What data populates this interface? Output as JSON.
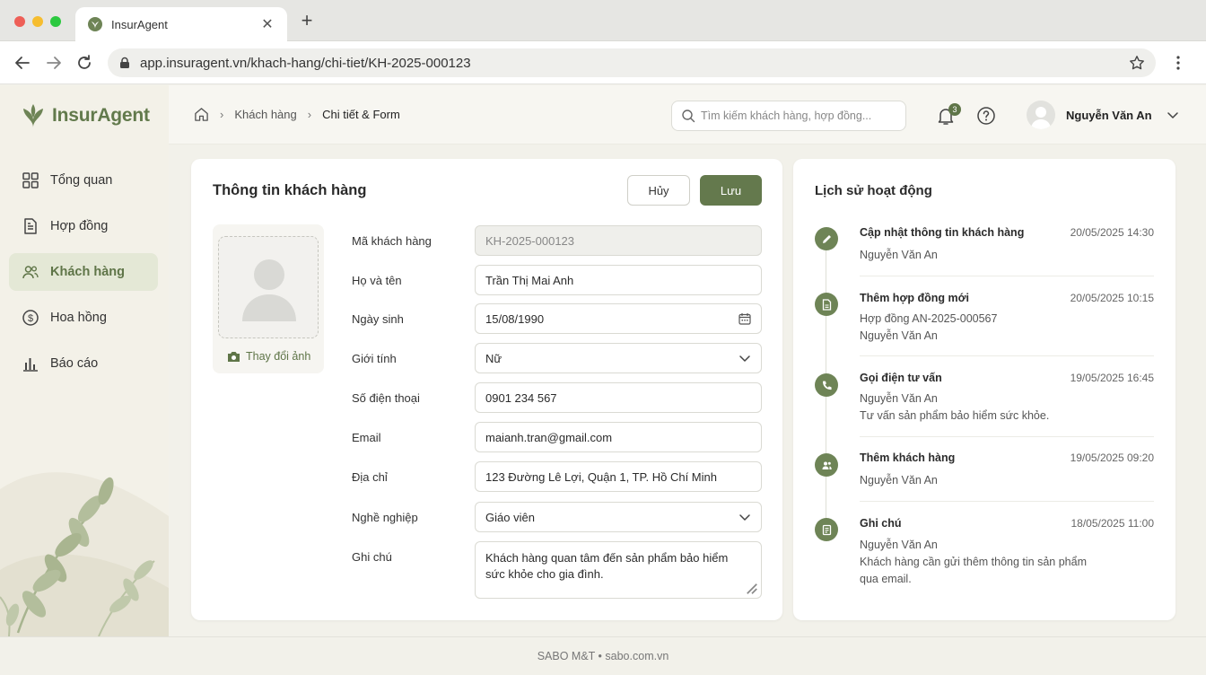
{
  "browser": {
    "tab_title": "InsurAgent",
    "url": "app.insuragent.vn/khach-hang/chi-tiet/KH-2025-000123",
    "icons": {
      "back": "back-arrow-icon",
      "forward": "forward-arrow-icon",
      "reload": "reload-icon",
      "lock": "lock-icon",
      "star": "star-icon",
      "menu": "kebab-menu-icon"
    }
  },
  "app": {
    "name": "InsurAgent",
    "accent": "#64794d"
  },
  "sidebar": {
    "items": [
      {
        "label": "Tổng quan",
        "icon": "dashboard-icon",
        "active": false
      },
      {
        "label": "Hợp đồng",
        "icon": "document-icon",
        "active": false
      },
      {
        "label": "Khách hàng",
        "icon": "users-icon",
        "active": true
      },
      {
        "label": "Hoa hồng",
        "icon": "dollar-circle-icon",
        "active": false
      },
      {
        "label": "Báo cáo",
        "icon": "bar-chart-icon",
        "active": false
      }
    ]
  },
  "header": {
    "breadcrumb": [
      "Khách hàng",
      "Chi tiết & Form"
    ],
    "search_placeholder": "Tìm kiếm khách hàng, hợp đồng...",
    "notification_count": "3",
    "user_name": "Nguyễn Văn An"
  },
  "form": {
    "title": "Thông tin khách hàng",
    "cancel_label": "Hủy",
    "save_label": "Lưu",
    "change_photo_label": "Thay đổi ảnh",
    "fields": [
      {
        "label": "Mã khách hàng",
        "value": "KH-2025-000123"
      },
      {
        "label": "Họ và tên",
        "value": "Trần Thị Mai Anh"
      },
      {
        "label": "Ngày sinh",
        "value": "15/08/1990"
      },
      {
        "label": "Giới tính",
        "value": "Nữ"
      },
      {
        "label": "Số điện thoại",
        "value": "0901 234 567"
      },
      {
        "label": "Email",
        "value": "maianh.tran@gmail.com"
      },
      {
        "label": "Địa chỉ",
        "value": "123 Đường Lê Lợi, Quận 1, TP. Hồ Chí Minh"
      },
      {
        "label": "Nghề nghiệp",
        "value": "Giáo viên"
      },
      {
        "label": "Ghi chú",
        "value_line1": "Khách hàng quan tâm đến sản phẩm bảo hiểm",
        "value_line2": "sức khỏe cho gia đình."
      }
    ]
  },
  "activity": {
    "title": "Lịch sử hoạt động",
    "items": [
      {
        "title": "Cập nhật thông tin khách hàng",
        "time": "20/05/2025 14:30",
        "lines": [
          "Nguyễn Văn An"
        ],
        "icon": "pencil-icon"
      },
      {
        "title": "Thêm hợp đồng mới",
        "time": "20/05/2025 10:15",
        "lines": [
          "Hợp đồng AN-2025-000567",
          "Nguyễn Văn An"
        ],
        "icon": "document-icon"
      },
      {
        "title": "Gọi điện tư vấn",
        "time": "19/05/2025 16:45",
        "lines": [
          "Nguyễn Văn An",
          "Tư vấn sản phẩm bảo hiểm sức khỏe."
        ],
        "icon": "phone-icon"
      },
      {
        "title": "Thêm khách hàng",
        "time": "19/05/2025 09:20",
        "lines": [
          "Nguyễn Văn An"
        ],
        "icon": "users-icon"
      },
      {
        "title": "Ghi chú",
        "time": "18/05/2025 11:00",
        "lines": [
          "Nguyễn Văn An",
          "Khách hàng cần gửi thêm thông tin sản phẩm",
          "qua email."
        ],
        "icon": "note-icon"
      }
    ]
  },
  "footer": {
    "text": "SABO M&T • sabo.com.vn"
  }
}
